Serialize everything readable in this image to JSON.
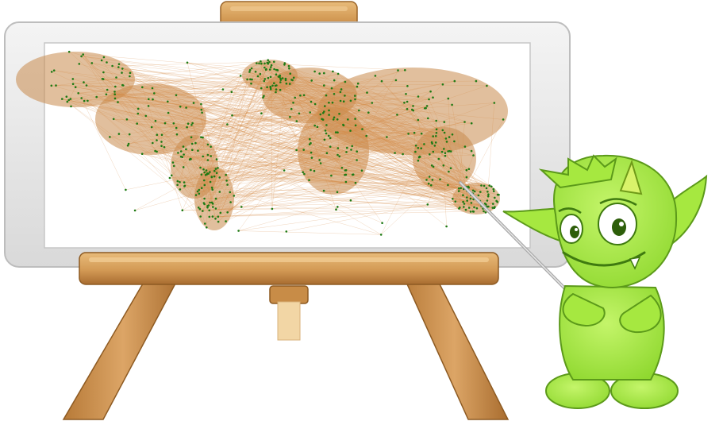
{
  "scene": {
    "colors": {
      "frame_outer": "#e8e8e8",
      "frame_inner": "#cfcfcf",
      "board": "#ffffff",
      "wood_light": "#e3b26e",
      "wood_mid": "#c98e47",
      "wood_dark": "#8a5a26",
      "wood_shadow": "#f1d4a3",
      "network_line": "#d48a45",
      "network_land": "#c98b4c",
      "airport_node": "#1e7a14",
      "goblin_body": "#a6e840",
      "goblin_shade": "#7cc42a",
      "goblin_outline": "#3f7a10",
      "goblin_horn": "#d7f06a",
      "pointer_stick": "#b8b8b8"
    },
    "icons": {
      "map": "world-airline-network-map",
      "character": "green-goblin-presenter",
      "stand": "wooden-easel"
    }
  }
}
